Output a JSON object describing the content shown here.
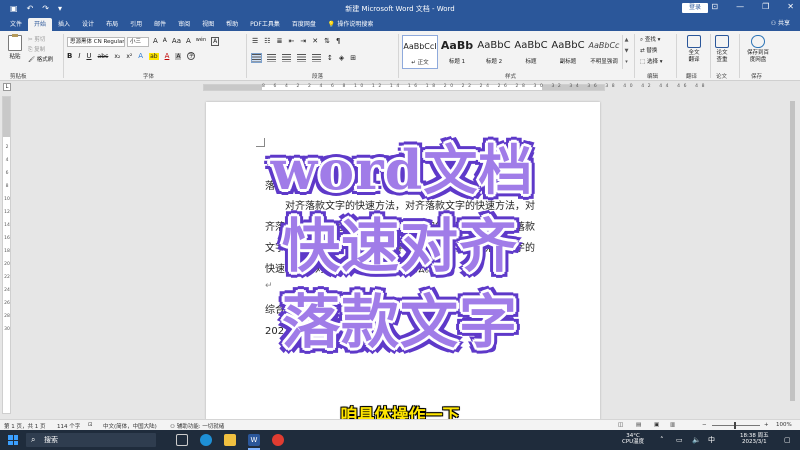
{
  "titlebar": {
    "title": "新建 Microsoft Word 文档 - Word",
    "login": "登录",
    "qa_icons": [
      "save-icon",
      "undo-icon",
      "redo-icon",
      "dropdown-icon"
    ],
    "window_controls": [
      "minimize-icon",
      "restore-icon",
      "close-icon"
    ]
  },
  "tabs": {
    "items": [
      "文件",
      "开始",
      "插入",
      "设计",
      "布局",
      "引用",
      "邮件",
      "审阅",
      "视图",
      "帮助",
      "PDF工具集",
      "百度网盘"
    ],
    "active": "开始",
    "search": "操作说明搜索",
    "share": "共享"
  },
  "ribbon": {
    "clipboard": {
      "paste": "粘贴",
      "cut": "剪切",
      "copy": "复制",
      "format_painter": "格式刷",
      "label": "剪贴板"
    },
    "font": {
      "name": "思源黑体 CN Regular",
      "size": "小三",
      "label": "字体",
      "bold": "B",
      "italic": "I",
      "underline": "U",
      "strike": "abc",
      "sub": "x₂",
      "sup": "x²",
      "highlight": "ab",
      "color": "A",
      "grow": "A",
      "shrink": "A",
      "case": "Aa",
      "clear": "A",
      "phonetic": "wén",
      "border": "A"
    },
    "paragraph": {
      "label": "段落"
    },
    "styles": {
      "label": "样式",
      "items": [
        {
          "sample": "AaBbCcI",
          "name": "正文"
        },
        {
          "sample": "AaBb",
          "name": "标题 1"
        },
        {
          "sample": "AaBbC",
          "name": "标题 2"
        },
        {
          "sample": "AaBbC",
          "name": "标题"
        },
        {
          "sample": "AaBbC",
          "name": "副标题"
        },
        {
          "sample": "AaBbCc",
          "name": "不明显强调"
        }
      ]
    },
    "editing": {
      "find": "查找",
      "replace": "替换",
      "select": "选择",
      "label": "编辑"
    },
    "translate": {
      "full": "全文翻译",
      "label": "翻译"
    },
    "paper": {
      "check": "论文查重",
      "label": "论文"
    },
    "save": {
      "baidu": "保存到百度网盘",
      "label": "保存"
    }
  },
  "ruler": {
    "top_numbers": "8 6 4 2 2 4 6 8 10 12 14 16 18 20 22 24 26 28 30 32 34 36 38 40 42 44 46 48",
    "left_numbers": [
      "2",
      "4",
      "6",
      "8",
      "10",
      "12",
      "14",
      "16",
      "18",
      "20",
      "22",
      "24",
      "26",
      "28",
      "30"
    ]
  },
  "document": {
    "lines": [
      "落款通知",
      "对齐落款文字的快速方法，对齐落款文字的快速方法，对",
      "齐落款文字的快速方法，对齐落款文字的快速方法，对齐落款",
      "文字的快速方法，对齐落款文字的快速方法，对齐落款文字的",
      "快速方法，对齐落款文字的快速方法。",
      "↵",
      "综合办公室",
      "2023 年 03 月 01 日"
    ]
  },
  "overlay": {
    "line1": "word文档",
    "line2": "快速对齐",
    "line3": "落款文字",
    "subtitle": "咱具体操作一下",
    "colors": {
      "fill": "#a07ce8",
      "outline": "#5e39c9",
      "subtitle": "#ffe600"
    }
  },
  "status": {
    "page": "第 1 页，共 1 页",
    "words": "114 个字",
    "language": "中文(简体，中国大陆)",
    "accessibility": "辅助功能: 一切就绪",
    "zoom": "100%"
  },
  "taskbar": {
    "search": "搜索",
    "weather_temp": "34°C",
    "weather_label": "CPU温度",
    "time": "18:38 周五",
    "date": "2023/3/1"
  }
}
